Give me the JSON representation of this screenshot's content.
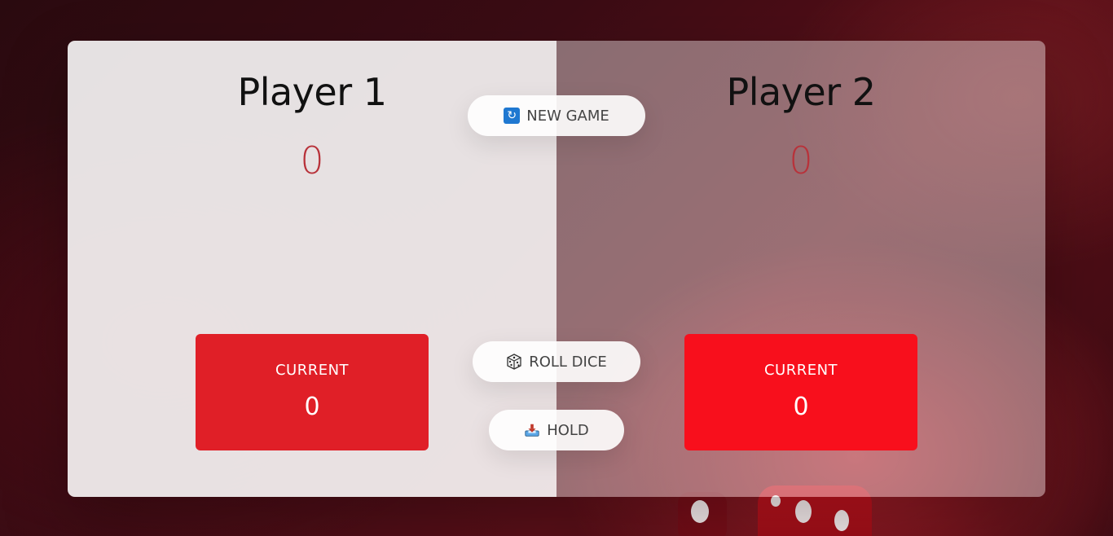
{
  "players": [
    {
      "name": "Player 1",
      "score": "0",
      "current_label": "CURRENT",
      "current_score": "0",
      "active": true
    },
    {
      "name": "Player 2",
      "score": "0",
      "current_label": "CURRENT",
      "current_score": "0",
      "active": false
    }
  ],
  "controls": {
    "new_game": {
      "label": "NEW GAME",
      "icon": "refresh-icon"
    },
    "roll_dice": {
      "label": "ROLL DICE",
      "icon": "dice-icon"
    },
    "hold": {
      "label": "HOLD",
      "icon": "inbox-tray-icon"
    }
  },
  "colors": {
    "score": "#b8323a",
    "current_active": "#e01f27",
    "current_inactive": "#f80f1c"
  }
}
